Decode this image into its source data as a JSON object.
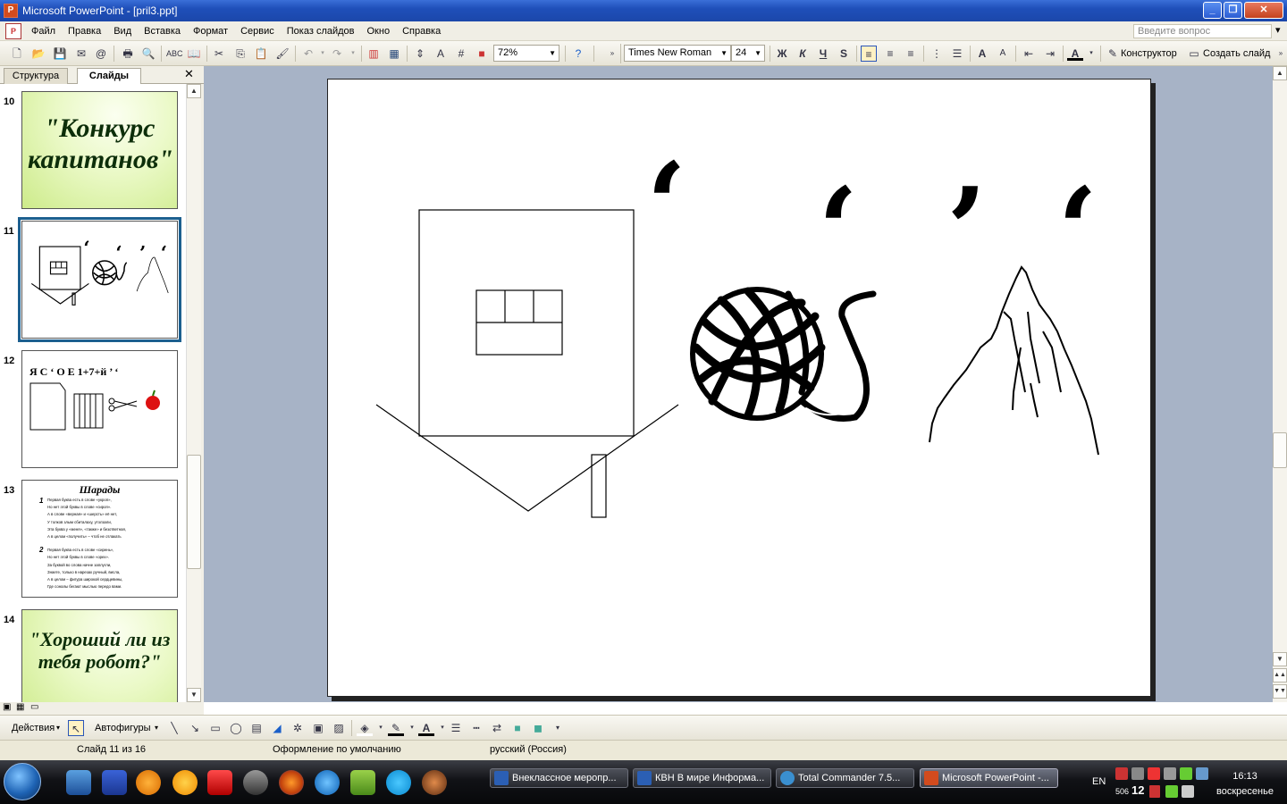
{
  "titlebar": {
    "title": "Microsoft PowerPoint - [pril3.ppt]",
    "minimize": "_",
    "restore": "❐",
    "close": "✕"
  },
  "menubar": {
    "items": [
      "Файл",
      "Правка",
      "Вид",
      "Вставка",
      "Формат",
      "Сервис",
      "Показ слайдов",
      "Окно",
      "Справка"
    ],
    "ask_placeholder": "Введите вопрос"
  },
  "toolbar": {
    "zoom": "72%",
    "font": "Times New Roman",
    "size": "24",
    "bold": "Ж",
    "italic": "К",
    "underline": "Ч",
    "shadow": "S",
    "designer": "Конструктор",
    "new_slide": "Создать слайд"
  },
  "left_panel": {
    "tab_structure": "Структура",
    "tab_slides": "Слайды",
    "slides": [
      {
        "num": "10",
        "title": "\"Конкурс капитанов\""
      },
      {
        "num": "11"
      },
      {
        "num": "12",
        "top_text": "Я С ‘  О Е  1+7+й ’ ‘"
      },
      {
        "num": "13",
        "title": "Шарады",
        "lines": [
          "Первая буква есть в слове «укроп»,",
          "Но нет этой буквы в слове «сироп».",
          "А в слове «верная» и «шерсть» её нет,",
          "У толков злым сбиталаху, утолзали,",
          "Эта буква у «меня», «также» и безответная,",
          "А в целом «получить» – чтоб не отлакать",
          "Первая буква есть в слове «сирень»,",
          "Но нет этой буквы в слове «орех».",
          "За буквой во слова начне заплугли,",
          "Знаете, только в нарезах ручный, висла,",
          "А в целом – фигура широкой сердцевины,",
          "Где соналы бегают мыслью передо вами."
        ]
      },
      {
        "num": "14",
        "title": "\"Хороший ли из тебя робот?\""
      }
    ]
  },
  "slide": {
    "commas": [
      "‘",
      "‘",
      "’",
      "‘"
    ]
  },
  "drawbar": {
    "actions": "Действия",
    "autoshapes": "Автофигуры"
  },
  "statusbar": {
    "slide_info": "Слайд 11 из 16",
    "design": "Оформление по умолчанию",
    "language": "русский (Россия)"
  },
  "taskbar": {
    "tasks": [
      {
        "label": "Внеклассное меропр...",
        "color": "#2b5fb4"
      },
      {
        "label": "КВН В мире Информа...",
        "color": "#2b5fb4"
      },
      {
        "label": "Total Commander 7.5...",
        "color": "#3a8fd0"
      },
      {
        "label": "Microsoft PowerPoint -...",
        "color": "#d24b1e"
      }
    ],
    "lang": "EN",
    "tray_num1": "506",
    "tray_num2": "12",
    "time": "16:13",
    "day": "воскресенье"
  }
}
